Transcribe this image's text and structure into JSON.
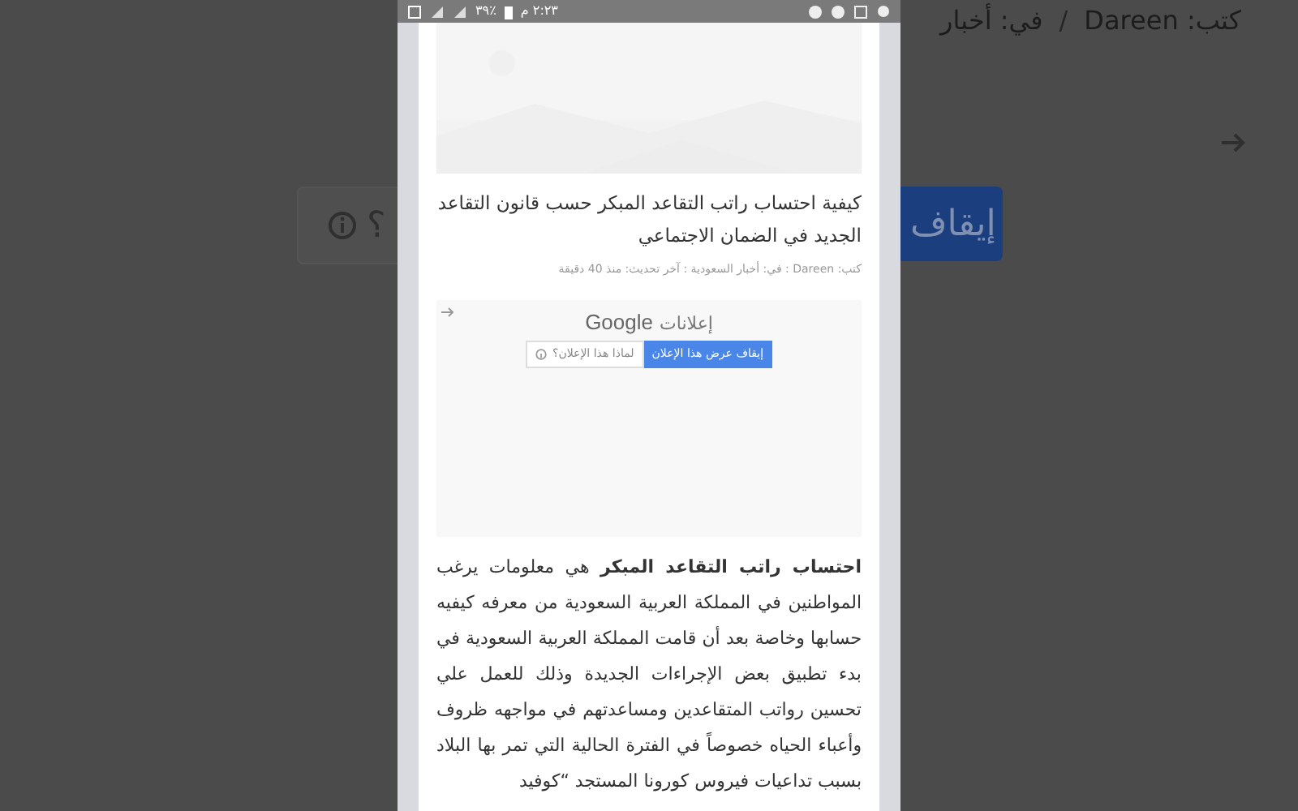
{
  "background": {
    "ad_question": "؟",
    "byline": [
      {
        "kind": "author",
        "text": "كتب: Dareen"
      },
      {
        "kind": "separator",
        "text": "/"
      },
      {
        "kind": "category",
        "text": "في: أخبار"
      }
    ],
    "stop_button": "إيقاف"
  },
  "status_bar": {
    "time": "٢:٢٣ م",
    "battery": "٣٩٪"
  },
  "article_card": {
    "kind": "picture",
    "title": "كيفية احتساب راتب التقاعد المبكر حسب قانون التقاعد الجديد في الضمان الاجتماعي",
    "meta": "كتب: Dareen : في: أخبار السعودية : آخر تحديث: منذ 40 دقيقة"
  },
  "ad": {
    "label": "إعلانات",
    "brand": "Google",
    "stop_button": "إيقاف عرض هذا الإعلان",
    "why_button": "لماذا هذا الإعلان؟"
  },
  "body": "**احتساب راتب التقاعد المبكر**  هي معلومات يرغب المواطنين في المملكة العربية السعودية من معرفه كيفيه حسابها وخاصة بعد أن قامت المملكة العربية السعودية في بدء تطبيق بعض الإجراءات الجديدة وذلك للعمل علي تحسين رواتب المتقاعدين ومساعدتهم في مواجهه ظروف وأعباء الحياه خصوصاً في الفترة الحالية التي تمر بها البلاد بسبب تداعيات فيروس كورونا المستجد “كوفيد"
}
